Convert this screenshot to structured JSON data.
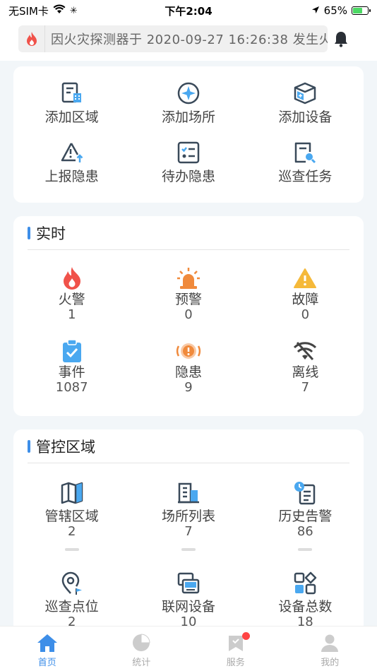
{
  "status_bar": {
    "carrier": "无SIM卡",
    "time": "下午2:04",
    "battery": "65%",
    "battery_level": 0.65
  },
  "notice": {
    "text": "因火灾探测器于 2020-09-27 16:26:38 发生火"
  },
  "quick_actions": [
    {
      "label": "添加区域",
      "icon": "document-building-icon"
    },
    {
      "label": "添加场所",
      "icon": "compass-icon"
    },
    {
      "label": "添加设备",
      "icon": "box-icon"
    },
    {
      "label": "上报隐患",
      "icon": "warning-upload-icon"
    },
    {
      "label": "待办隐患",
      "icon": "checklist-icon"
    },
    {
      "label": "巡查任务",
      "icon": "document-search-icon"
    }
  ],
  "realtime": {
    "title": "实时",
    "items": [
      {
        "label": "火警",
        "count": "1",
        "icon": "fire-icon",
        "color": "#f0524a"
      },
      {
        "label": "预警",
        "count": "0",
        "icon": "alarm-light-icon",
        "color": "#f08a3c"
      },
      {
        "label": "故障",
        "count": "0",
        "icon": "warning-triangle-icon",
        "color": "#f5b93a"
      },
      {
        "label": "事件",
        "count": "1087",
        "icon": "clipboard-check-icon",
        "color": "#4aa8f0"
      },
      {
        "label": "隐患",
        "count": "9",
        "icon": "hazard-circle-icon",
        "color": "#f08a3c"
      },
      {
        "label": "离线",
        "count": "7",
        "icon": "wifi-off-icon",
        "color": "#444444"
      }
    ]
  },
  "area": {
    "title": "管控区域",
    "items": [
      {
        "label": "管辖区域",
        "count": "2",
        "icon": "map-icon"
      },
      {
        "label": "场所列表",
        "count": "7",
        "icon": "buildings-icon"
      },
      {
        "label": "历史告警",
        "count": "86",
        "icon": "history-doc-icon"
      },
      {
        "label": "巡查点位",
        "count": "2",
        "icon": "location-flag-icon"
      },
      {
        "label": "联网设备",
        "count": "10",
        "icon": "devices-icon"
      },
      {
        "label": "设备总数",
        "count": "18",
        "icon": "apps-icon"
      }
    ]
  },
  "tabbar": [
    {
      "label": "首页",
      "icon": "home-icon",
      "active": true
    },
    {
      "label": "统计",
      "icon": "pie-chart-icon",
      "active": false
    },
    {
      "label": "服务",
      "icon": "service-icon",
      "active": false
    },
    {
      "label": "我的",
      "icon": "user-icon",
      "active": false
    }
  ],
  "colors": {
    "accent": "#3d8ee8",
    "icon_dark": "#3a4a5a",
    "icon_blue": "#4aa8f0"
  }
}
